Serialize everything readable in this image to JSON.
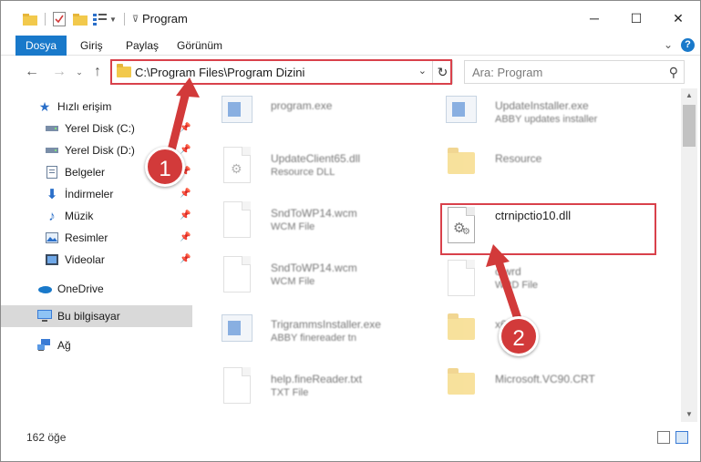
{
  "window": {
    "title": "Program",
    "minimize": "─",
    "maximize": "☐",
    "close": "✕"
  },
  "ribbon": {
    "tabs": [
      "Dosya",
      "Giriş",
      "Paylaş",
      "Görünüm"
    ],
    "help": "?"
  },
  "address": {
    "path": "C:\\Program Files\\Program Dizini"
  },
  "search": {
    "placeholder": "Ara: Program"
  },
  "sidebar": {
    "quick_access": "Hızlı erişim",
    "items": [
      {
        "label": "Yerel Disk (C:)",
        "icon": "drive-icon"
      },
      {
        "label": "Yerel Disk (D:)",
        "icon": "drive-icon"
      },
      {
        "label": "Belgeler",
        "icon": "documents-icon"
      },
      {
        "label": "İndirmeler",
        "icon": "download-icon"
      },
      {
        "label": "Müzik",
        "icon": "music-icon"
      },
      {
        "label": "Resimler",
        "icon": "pictures-icon"
      },
      {
        "label": "Videolar",
        "icon": "videos-icon"
      }
    ],
    "onedrive": "OneDrive",
    "this_pc": "Bu bilgisayar",
    "network": "Ağ"
  },
  "files": [
    {
      "name": "program.exe",
      "type": "",
      "icon": "app"
    },
    {
      "name": "UpdateInstaller.exe",
      "type": "ABBY updates installer",
      "icon": "app"
    },
    {
      "name": "UpdateClient65.dll",
      "type": "Resource DLL",
      "icon": "dll"
    },
    {
      "name": "Resource",
      "type": "",
      "icon": "folder"
    },
    {
      "name": "SndToWP14.wcm",
      "type": "WCM File",
      "icon": "doc"
    },
    {
      "name": "ctrnipctio10.dll",
      "type": "",
      "icon": "dll"
    },
    {
      "name": "SndToWP14.wcm",
      "type": "WCM File",
      "icon": "doc"
    },
    {
      "name": "c.wrd",
      "type": "WRD File",
      "icon": "doc"
    },
    {
      "name": "TrigrammsInstaller.exe",
      "type": "ABBY finereader tn",
      "icon": "app"
    },
    {
      "name": "x64",
      "type": "",
      "icon": "folder"
    },
    {
      "name": "help.fineReader.txt",
      "type": "TXT File",
      "icon": "doc"
    },
    {
      "name": "Microsoft.VC90.CRT",
      "type": "",
      "icon": "folder"
    }
  ],
  "status": {
    "count": "162 öğe"
  },
  "callouts": {
    "one": "1",
    "two": "2"
  },
  "colors": {
    "accent": "#1979ca",
    "highlight": "#d9414b",
    "callout": "#d23a3a"
  }
}
